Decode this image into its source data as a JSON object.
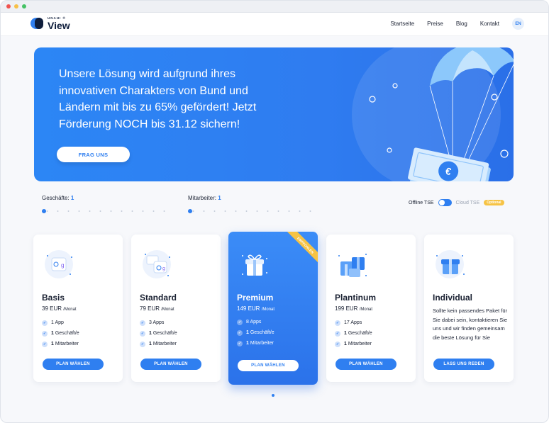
{
  "header": {
    "logo_top": "UNAHI ®",
    "logo_main": "View",
    "nav": [
      "Startseite",
      "Preise",
      "Blog",
      "Kontakt"
    ],
    "lang": "EN"
  },
  "hero": {
    "text": "Unsere Lösung wird aufgrund ihres innovativen Charakters von Bund und Ländern mit bis zu 65% gefördert! Jetzt Förderung NOCH bis 31.12 sichern!",
    "button": "FRAG UNS"
  },
  "filters": {
    "shops_label": "Geschäfte:",
    "shops_value": "1",
    "staff_label": "Mitarbeiter:",
    "staff_value": "1",
    "offline_label": "Offline TSE",
    "cloud_label": "Cloud TSE",
    "optional_badge": "Optional"
  },
  "plans": [
    {
      "title": "Basis",
      "price": "39 EUR",
      "per": "/Monat",
      "features": [
        {
          "bold": "",
          "text": "1 App"
        },
        {
          "bold": "1",
          "text": " Geschäft/e"
        },
        {
          "bold": "1",
          "text": " Mitarbeiter"
        }
      ],
      "button": "PLAN WÄHLEN"
    },
    {
      "title": "Standard",
      "price": "79 EUR",
      "per": "/Monat",
      "features": [
        {
          "bold": "",
          "text": "3 Apps"
        },
        {
          "bold": "1",
          "text": " Geschäft/e"
        },
        {
          "bold": "1",
          "text": " Mitarbeiter"
        }
      ],
      "button": "PLAN WÄHLEN"
    },
    {
      "title": "Premium",
      "price": "149 EUR",
      "per": "/Monat",
      "ribbon": "EMPFOHLEN",
      "features": [
        {
          "bold": "",
          "text": "8 Apps"
        },
        {
          "bold": "1",
          "text": " Geschäft/e"
        },
        {
          "bold": "1",
          "text": " Mitarbeiter"
        }
      ],
      "button": "PLAN WÄHLEN"
    },
    {
      "title": "Plantinum",
      "price": "199 EUR",
      "per": "/Monat",
      "features": [
        {
          "bold": "",
          "text": "17 Apps"
        },
        {
          "bold": "1",
          "text": " Geschäft/e"
        },
        {
          "bold": "1",
          "text": " Mitarbeiter"
        }
      ],
      "button": "PLAN WÄHLEN"
    },
    {
      "title": "Individual",
      "desc": "Sollte kein passendes Paket für Sie dabei sein, kontaktieren Sie uns und wir finden gemeinsam die beste Lösung für Sie",
      "button": "LASS UNS REDEN"
    }
  ],
  "icons": {
    "plan_icons": [
      "app-grid-icon",
      "app-grid-icon",
      "gift-box-icon",
      "gift-boxes-icon",
      "gift-box-icon"
    ],
    "hero_art": "parachute-money-icon"
  },
  "colors": {
    "accent": "#2f7ff0",
    "badge": "#f6c344"
  }
}
